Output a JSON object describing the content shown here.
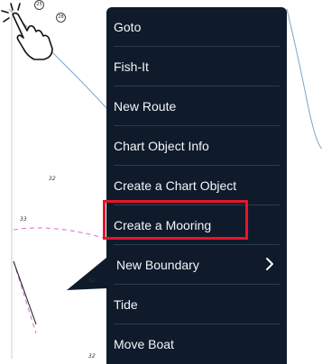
{
  "chart": {
    "depths": [
      "32",
      "33",
      "32",
      "32"
    ],
    "marker_top": "28",
    "marker_top_left": "25"
  },
  "menu": {
    "items": [
      {
        "label": "Goto"
      },
      {
        "label": "Fish-It"
      },
      {
        "label": "New Route"
      },
      {
        "label": "Chart Object Info"
      },
      {
        "label": "Create a Chart Object"
      },
      {
        "label": "Create a Mooring"
      },
      {
        "label": "New Boundary"
      },
      {
        "label": "Tide"
      },
      {
        "label": "Move Boat"
      }
    ],
    "highlighted_index": 5,
    "submenu_indicator": "chevron-right-icon"
  },
  "colors": {
    "menu_bg": "#0f1b2b",
    "highlight": "#e8142a",
    "boundary_line": "#d46fd0",
    "coast_line": "#7aa4c8"
  }
}
